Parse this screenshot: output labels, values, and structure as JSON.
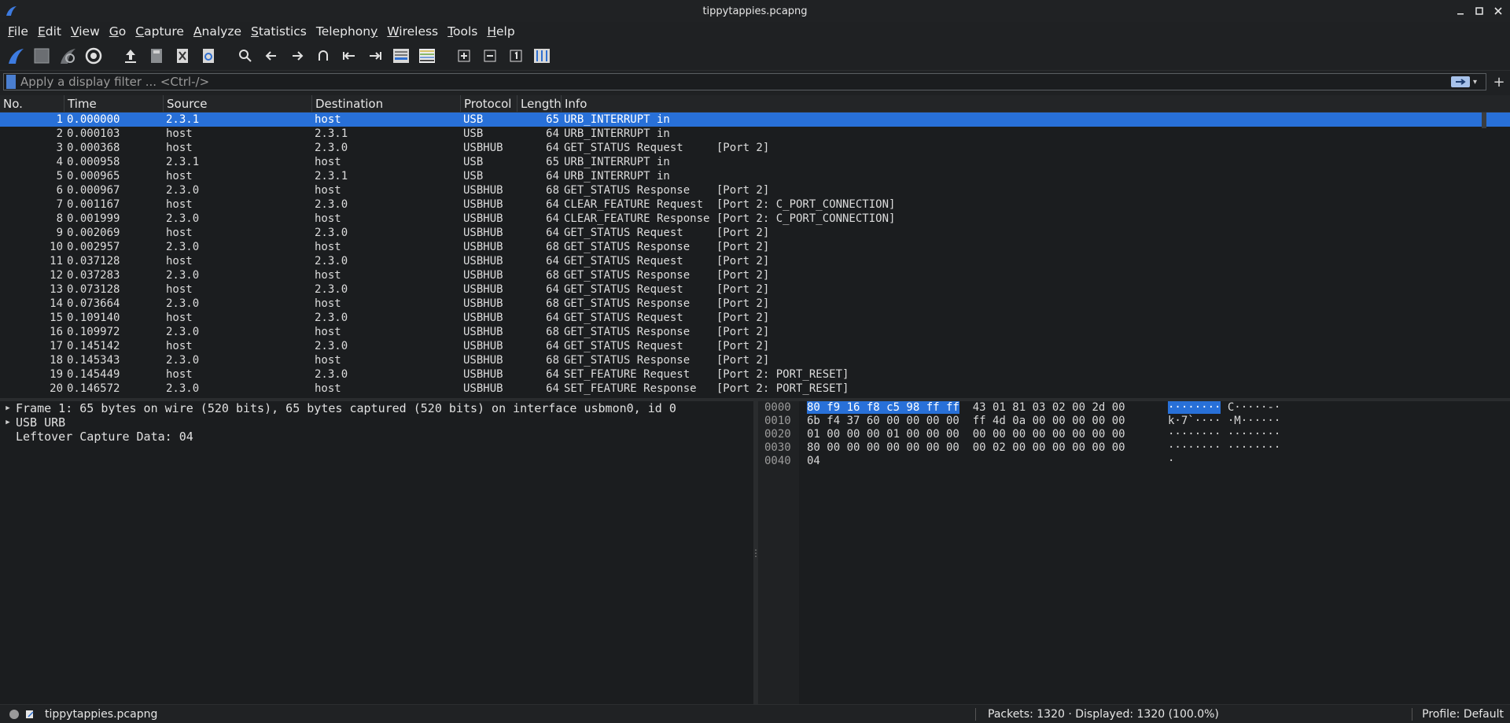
{
  "window": {
    "title": "tippytappies.pcapng",
    "controls": [
      "_",
      "□",
      "×"
    ]
  },
  "menubar": {
    "items": [
      {
        "label": "File",
        "key": "F"
      },
      {
        "label": "Edit",
        "key": "E"
      },
      {
        "label": "View",
        "key": "V"
      },
      {
        "label": "Go",
        "key": "G"
      },
      {
        "label": "Capture",
        "key": "C"
      },
      {
        "label": "Analyze",
        "key": "A"
      },
      {
        "label": "Statistics",
        "key": "S"
      },
      {
        "label": "Telephony",
        "key": "y"
      },
      {
        "label": "Wireless",
        "key": "W"
      },
      {
        "label": "Tools",
        "key": "T"
      },
      {
        "label": "Help",
        "key": "H"
      }
    ]
  },
  "toolbar": {
    "icons": [
      "shark-fin-start-icon",
      "stop-square-icon",
      "restart-fin-icon",
      "gear-options-icon",
      "open-file-icon",
      "save-file-icon",
      "close-file-icon",
      "reload-icon",
      "find-icon",
      "back-arrow-icon",
      "forward-arrow-icon",
      "go-to-packet-icon",
      "first-packet-icon",
      "last-packet-icon",
      "auto-scroll-icon",
      "colorize-icon",
      "zoom-in-icon",
      "zoom-out-icon",
      "normal-size-icon",
      "resize-columns-icon"
    ]
  },
  "filter": {
    "placeholder": "Apply a display filter ... <Ctrl-/>",
    "value": "",
    "add_button": "+"
  },
  "packet_list": {
    "columns": [
      "No.",
      "Time",
      "Source",
      "Destination",
      "Protocol",
      "Length",
      "Info"
    ],
    "selected_index": 0,
    "rows": [
      {
        "no": "1",
        "time": "0.000000",
        "source": "2.3.1",
        "destination": "host",
        "protocol": "USB",
        "length": "65",
        "info": "URB_INTERRUPT in"
      },
      {
        "no": "2",
        "time": "0.000103",
        "source": "host",
        "destination": "2.3.1",
        "protocol": "USB",
        "length": "64",
        "info": "URB_INTERRUPT in"
      },
      {
        "no": "3",
        "time": "0.000368",
        "source": "host",
        "destination": "2.3.0",
        "protocol": "USBHUB",
        "length": "64",
        "info": "GET_STATUS Request     [Port 2]"
      },
      {
        "no": "4",
        "time": "0.000958",
        "source": "2.3.1",
        "destination": "host",
        "protocol": "USB",
        "length": "65",
        "info": "URB_INTERRUPT in"
      },
      {
        "no": "5",
        "time": "0.000965",
        "source": "host",
        "destination": "2.3.1",
        "protocol": "USB",
        "length": "64",
        "info": "URB_INTERRUPT in"
      },
      {
        "no": "6",
        "time": "0.000967",
        "source": "2.3.0",
        "destination": "host",
        "protocol": "USBHUB",
        "length": "68",
        "info": "GET_STATUS Response    [Port 2]"
      },
      {
        "no": "7",
        "time": "0.001167",
        "source": "host",
        "destination": "2.3.0",
        "protocol": "USBHUB",
        "length": "64",
        "info": "CLEAR_FEATURE Request  [Port 2: C_PORT_CONNECTION]"
      },
      {
        "no": "8",
        "time": "0.001999",
        "source": "2.3.0",
        "destination": "host",
        "protocol": "USBHUB",
        "length": "64",
        "info": "CLEAR_FEATURE Response [Port 2: C_PORT_CONNECTION]"
      },
      {
        "no": "9",
        "time": "0.002069",
        "source": "host",
        "destination": "2.3.0",
        "protocol": "USBHUB",
        "length": "64",
        "info": "GET_STATUS Request     [Port 2]"
      },
      {
        "no": "10",
        "time": "0.002957",
        "source": "2.3.0",
        "destination": "host",
        "protocol": "USBHUB",
        "length": "68",
        "info": "GET_STATUS Response    [Port 2]"
      },
      {
        "no": "11",
        "time": "0.037128",
        "source": "host",
        "destination": "2.3.0",
        "protocol": "USBHUB",
        "length": "64",
        "info": "GET_STATUS Request     [Port 2]"
      },
      {
        "no": "12",
        "time": "0.037283",
        "source": "2.3.0",
        "destination": "host",
        "protocol": "USBHUB",
        "length": "68",
        "info": "GET_STATUS Response    [Port 2]"
      },
      {
        "no": "13",
        "time": "0.073128",
        "source": "host",
        "destination": "2.3.0",
        "protocol": "USBHUB",
        "length": "64",
        "info": "GET_STATUS Request     [Port 2]"
      },
      {
        "no": "14",
        "time": "0.073664",
        "source": "2.3.0",
        "destination": "host",
        "protocol": "USBHUB",
        "length": "68",
        "info": "GET_STATUS Response    [Port 2]"
      },
      {
        "no": "15",
        "time": "0.109140",
        "source": "host",
        "destination": "2.3.0",
        "protocol": "USBHUB",
        "length": "64",
        "info": "GET_STATUS Request     [Port 2]"
      },
      {
        "no": "16",
        "time": "0.109972",
        "source": "2.3.0",
        "destination": "host",
        "protocol": "USBHUB",
        "length": "68",
        "info": "GET_STATUS Response    [Port 2]"
      },
      {
        "no": "17",
        "time": "0.145142",
        "source": "host",
        "destination": "2.3.0",
        "protocol": "USBHUB",
        "length": "64",
        "info": "GET_STATUS Request     [Port 2]"
      },
      {
        "no": "18",
        "time": "0.145343",
        "source": "2.3.0",
        "destination": "host",
        "protocol": "USBHUB",
        "length": "68",
        "info": "GET_STATUS Response    [Port 2]"
      },
      {
        "no": "19",
        "time": "0.145449",
        "source": "host",
        "destination": "2.3.0",
        "protocol": "USBHUB",
        "length": "64",
        "info": "SET_FEATURE Request    [Port 2: PORT_RESET]"
      },
      {
        "no": "20",
        "time": "0.146572",
        "source": "2.3.0",
        "destination": "host",
        "protocol": "USBHUB",
        "length": "64",
        "info": "SET_FEATURE Response   [Port 2: PORT_RESET]"
      }
    ]
  },
  "details": {
    "rows": [
      {
        "expandable": true,
        "text": "Frame 1: 65 bytes on wire (520 bits), 65 bytes captured (520 bits) on interface usbmon0, id 0"
      },
      {
        "expandable": true,
        "text": "USB URB"
      },
      {
        "expandable": false,
        "text": "Leftover Capture Data: 04"
      }
    ]
  },
  "bytes": {
    "rows": [
      {
        "offset": "0000",
        "hex_hl": "80 f9 16 f8 c5 98 ff ff",
        "hex_rest": "  43 01 81 03 02 00 2d 00",
        "ascii_hl": "········",
        "ascii_rest": " C·····-·"
      },
      {
        "offset": "0010",
        "hex_hl": "",
        "hex_rest": "6b f4 37 60 00 00 00 00  ff 4d 0a 00 00 00 00 00",
        "ascii_hl": "",
        "ascii_rest": "k·7`···· ·M······"
      },
      {
        "offset": "0020",
        "hex_hl": "",
        "hex_rest": "01 00 00 00 01 00 00 00  00 00 00 00 00 00 00 00",
        "ascii_hl": "",
        "ascii_rest": "········ ········"
      },
      {
        "offset": "0030",
        "hex_hl": "",
        "hex_rest": "80 00 00 00 00 00 00 00  00 02 00 00 00 00 00 00",
        "ascii_hl": "",
        "ascii_rest": "········ ········"
      },
      {
        "offset": "0040",
        "hex_hl": "",
        "hex_rest": "04",
        "ascii_hl": "",
        "ascii_rest": "·"
      }
    ]
  },
  "status": {
    "file": "tippytappies.pcapng",
    "packets": "Packets: 1320 · Displayed: 1320 (100.0%)",
    "profile": "Profile: Default"
  },
  "colors": {
    "selection": "#2870d8",
    "background": "#1b1d1f",
    "accent": "#4a7fd1"
  }
}
